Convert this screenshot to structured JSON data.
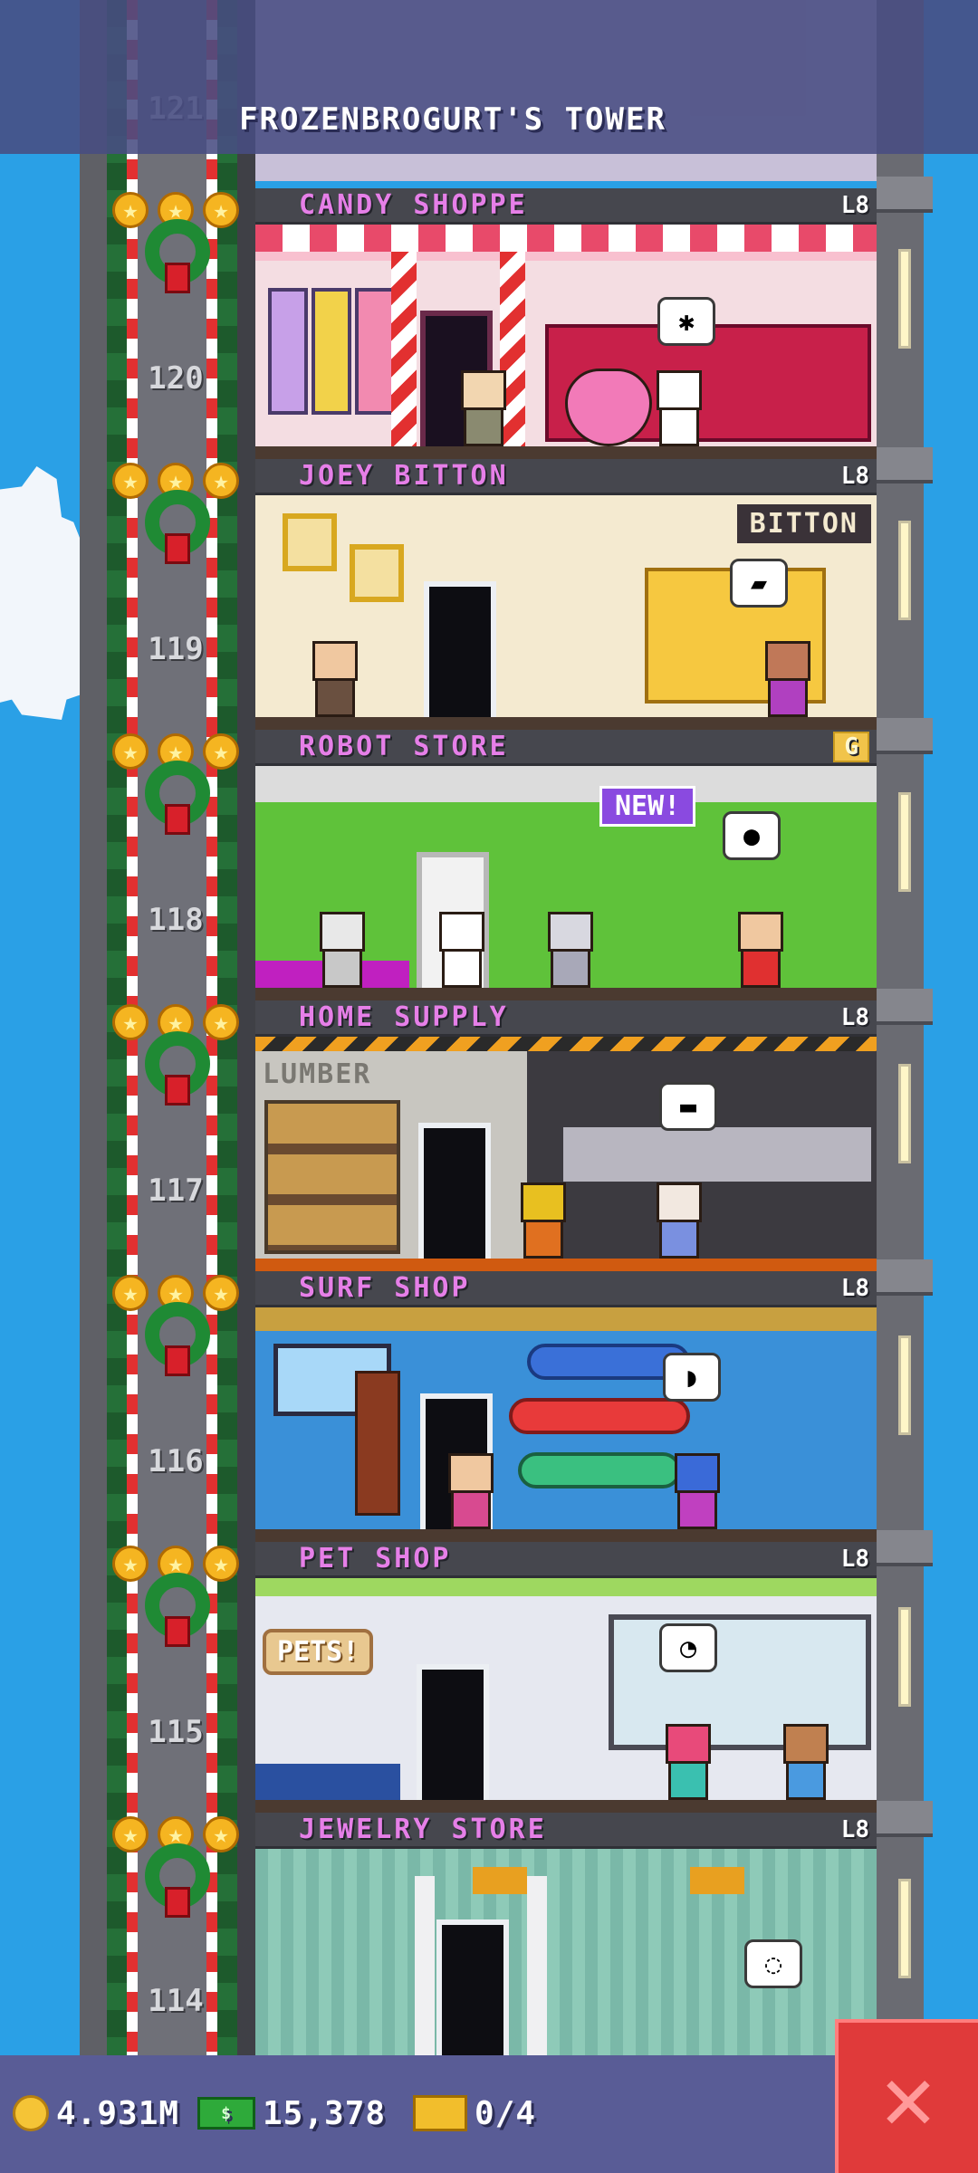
{
  "header": {
    "title": "FROZENBROGURT'S TOWER"
  },
  "top_floor_number": "121",
  "floors": [
    {
      "name": "CANDY SHOPPE",
      "level": "L8",
      "number": "120"
    },
    {
      "name": "JOEY BITTON",
      "level": "L8",
      "number": "119",
      "sign": "BITTON"
    },
    {
      "name": "ROBOT STORE",
      "level": "G",
      "number": "118",
      "badge": "NEW!"
    },
    {
      "name": "HOME SUPPLY",
      "level": "L8",
      "number": "117",
      "sign": "LUMBER"
    },
    {
      "name": "SURF SHOP",
      "level": "L8",
      "number": "116"
    },
    {
      "name": "PET SHOP",
      "level": "L8",
      "number": "115",
      "sign": "PETS!"
    },
    {
      "name": "JEWELRY STORE",
      "level": "L8",
      "number": "114"
    }
  ],
  "stats": {
    "coins": "4.931M",
    "bux": "15,378",
    "tickets": "0/4"
  },
  "close_button": {
    "label": "✕"
  },
  "colors": {
    "floor_name": "#e67fe8",
    "sky": "#2aa0e6",
    "close": "#e03a3a"
  }
}
